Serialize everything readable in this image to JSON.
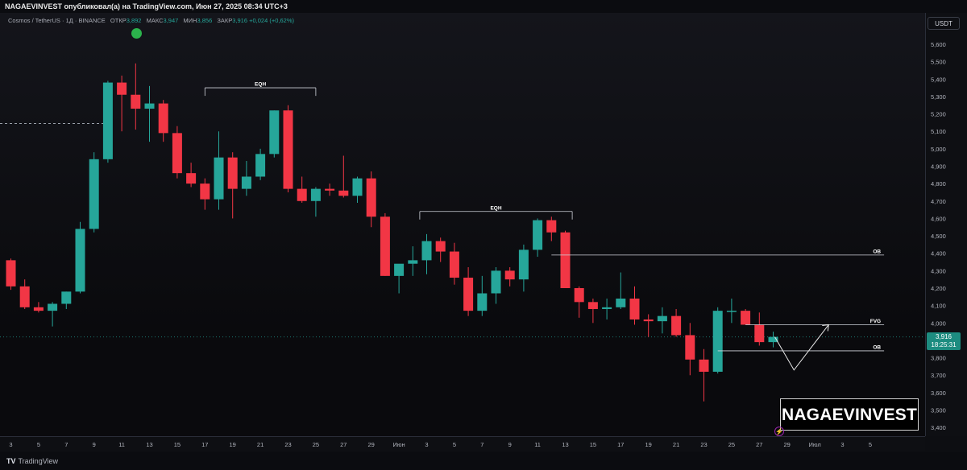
{
  "header": {
    "publish_line": "NAGAEVINVEST опубликовал(а) на TradingView.com, Июн 27, 2025 08:34 UTC+3"
  },
  "legend": {
    "symbol": "Cosmos / TetherUS · 1Д · BINANCE",
    "open_label": "ОТКР",
    "open_value": "3,892",
    "high_label": "МАКС",
    "high_value": "3,947",
    "low_label": "МИН",
    "low_value": "3,856",
    "close_label": "ЗАКР",
    "close_value": "3,916",
    "change": "+0,024 (+0,62%)"
  },
  "currency": "USDT",
  "last_price": {
    "value": "3,916",
    "countdown": "18:25:31"
  },
  "watermark": "NAGAEVINVEST",
  "footer": {
    "brand": "TradingView"
  },
  "colors": {
    "up": "#26a69a",
    "down": "#f23645",
    "background": "#0d0e12",
    "annotation": "#d1d4dc"
  },
  "chart_data": {
    "type": "candlestick",
    "ylim": [
      3.35,
      5.78
    ],
    "y_ticks": [
      "5,600",
      "5,500",
      "5,400",
      "5,300",
      "5,200",
      "5,100",
      "5,000",
      "4,900",
      "4,800",
      "4,700",
      "4,600",
      "4,500",
      "4,400",
      "4,300",
      "4,200",
      "4,100",
      "4,000",
      "3,900",
      "3,800",
      "3,700",
      "3,600",
      "3,500",
      "3,400"
    ],
    "x_ticks": [
      "3",
      "5",
      "7",
      "9",
      "11",
      "13",
      "15",
      "17",
      "19",
      "21",
      "23",
      "25",
      "27",
      "29",
      "Июн",
      "3",
      "5",
      "7",
      "9",
      "11",
      "13",
      "15",
      "17",
      "19",
      "21",
      "23",
      "25",
      "27",
      "29",
      "Июл",
      "3",
      "5"
    ],
    "candles": [
      {
        "o": 4.36,
        "h": 4.37,
        "l": 4.19,
        "c": 4.21
      },
      {
        "o": 4.21,
        "h": 4.25,
        "l": 4.08,
        "c": 4.09
      },
      {
        "o": 4.09,
        "h": 4.12,
        "l": 4.06,
        "c": 4.07
      },
      {
        "o": 4.07,
        "h": 4.12,
        "l": 3.98,
        "c": 4.11
      },
      {
        "o": 4.11,
        "h": 4.18,
        "l": 4.08,
        "c": 4.18
      },
      {
        "o": 4.18,
        "h": 4.58,
        "l": 4.17,
        "c": 4.54
      },
      {
        "o": 4.54,
        "h": 4.98,
        "l": 4.52,
        "c": 4.94
      },
      {
        "o": 4.94,
        "h": 5.39,
        "l": 4.92,
        "c": 5.38
      },
      {
        "o": 5.38,
        "h": 5.42,
        "l": 5.1,
        "c": 5.31
      },
      {
        "o": 5.31,
        "h": 5.49,
        "l": 5.11,
        "c": 5.23
      },
      {
        "o": 5.23,
        "h": 5.36,
        "l": 5.04,
        "c": 5.26
      },
      {
        "o": 5.26,
        "h": 5.28,
        "l": 5.04,
        "c": 5.09
      },
      {
        "o": 5.09,
        "h": 5.13,
        "l": 4.83,
        "c": 4.86
      },
      {
        "o": 4.86,
        "h": 4.92,
        "l": 4.78,
        "c": 4.8
      },
      {
        "o": 4.8,
        "h": 4.83,
        "l": 4.65,
        "c": 4.71
      },
      {
        "o": 4.71,
        "h": 5.1,
        "l": 4.65,
        "c": 4.95
      },
      {
        "o": 4.95,
        "h": 4.98,
        "l": 4.6,
        "c": 4.77
      },
      {
        "o": 4.77,
        "h": 4.93,
        "l": 4.73,
        "c": 4.84
      },
      {
        "o": 4.84,
        "h": 5.0,
        "l": 4.82,
        "c": 4.97
      },
      {
        "o": 4.97,
        "h": 5.22,
        "l": 4.95,
        "c": 5.22
      },
      {
        "o": 5.22,
        "h": 5.25,
        "l": 4.75,
        "c": 4.77
      },
      {
        "o": 4.77,
        "h": 4.84,
        "l": 4.69,
        "c": 4.7
      },
      {
        "o": 4.7,
        "h": 4.78,
        "l": 4.61,
        "c": 4.77
      },
      {
        "o": 4.77,
        "h": 4.8,
        "l": 4.73,
        "c": 4.76
      },
      {
        "o": 4.76,
        "h": 4.96,
        "l": 4.72,
        "c": 4.73
      },
      {
        "o": 4.73,
        "h": 4.84,
        "l": 4.69,
        "c": 4.83
      },
      {
        "o": 4.83,
        "h": 4.87,
        "l": 4.55,
        "c": 4.61
      },
      {
        "o": 4.61,
        "h": 4.63,
        "l": 4.27,
        "c": 4.27
      },
      {
        "o": 4.27,
        "h": 4.31,
        "l": 4.17,
        "c": 4.34
      },
      {
        "o": 4.34,
        "h": 4.44,
        "l": 4.27,
        "c": 4.36
      },
      {
        "o": 4.36,
        "h": 4.51,
        "l": 4.28,
        "c": 4.47
      },
      {
        "o": 4.47,
        "h": 4.49,
        "l": 4.35,
        "c": 4.41
      },
      {
        "o": 4.41,
        "h": 4.46,
        "l": 4.22,
        "c": 4.26
      },
      {
        "o": 4.26,
        "h": 4.32,
        "l": 4.04,
        "c": 4.07
      },
      {
        "o": 4.07,
        "h": 4.27,
        "l": 4.04,
        "c": 4.17
      },
      {
        "o": 4.17,
        "h": 4.32,
        "l": 4.11,
        "c": 4.3
      },
      {
        "o": 4.3,
        "h": 4.32,
        "l": 4.21,
        "c": 4.25
      },
      {
        "o": 4.25,
        "h": 4.45,
        "l": 4.18,
        "c": 4.42
      },
      {
        "o": 4.42,
        "h": 4.6,
        "l": 4.38,
        "c": 4.59
      },
      {
        "o": 4.59,
        "h": 4.61,
        "l": 4.47,
        "c": 4.52
      },
      {
        "o": 4.52,
        "h": 4.53,
        "l": 4.2,
        "c": 4.2
      },
      {
        "o": 4.2,
        "h": 4.21,
        "l": 4.03,
        "c": 4.12
      },
      {
        "o": 4.12,
        "h": 4.14,
        "l": 4.0,
        "c": 4.08
      },
      {
        "o": 4.08,
        "h": 4.14,
        "l": 4.02,
        "c": 4.09
      },
      {
        "o": 4.09,
        "h": 4.29,
        "l": 4.08,
        "c": 4.14
      },
      {
        "o": 4.14,
        "h": 4.21,
        "l": 3.99,
        "c": 4.02
      },
      {
        "o": 4.02,
        "h": 4.05,
        "l": 3.92,
        "c": 4.01
      },
      {
        "o": 4.01,
        "h": 4.09,
        "l": 3.94,
        "c": 4.04
      },
      {
        "o": 4.04,
        "h": 4.08,
        "l": 3.92,
        "c": 3.93
      },
      {
        "o": 3.93,
        "h": 4.0,
        "l": 3.7,
        "c": 3.79
      },
      {
        "o": 3.79,
        "h": 3.85,
        "l": 3.55,
        "c": 3.72
      },
      {
        "o": 3.72,
        "h": 4.09,
        "l": 3.71,
        "c": 4.07
      },
      {
        "o": 4.07,
        "h": 4.14,
        "l": 4.0,
        "c": 4.07
      },
      {
        "o": 4.07,
        "h": 4.08,
        "l": 3.99,
        "c": 3.99
      },
      {
        "o": 3.99,
        "h": 4.06,
        "l": 3.87,
        "c": 3.89
      },
      {
        "o": 3.89,
        "h": 3.95,
        "l": 3.86,
        "c": 3.92
      }
    ],
    "annotations": [
      {
        "text": "EQH",
        "price": 5.35,
        "from": 14,
        "to": 22
      },
      {
        "text": "EQH",
        "price": 4.64,
        "from": 29.5,
        "to": 40.5
      },
      {
        "text": "OB",
        "price": 4.39,
        "from": 39,
        "to": 63
      },
      {
        "text": "FVG",
        "price": 3.99,
        "from": 53,
        "to": 63
      },
      {
        "text": "OB",
        "price": 3.84,
        "from": 51,
        "to": 63
      }
    ]
  }
}
